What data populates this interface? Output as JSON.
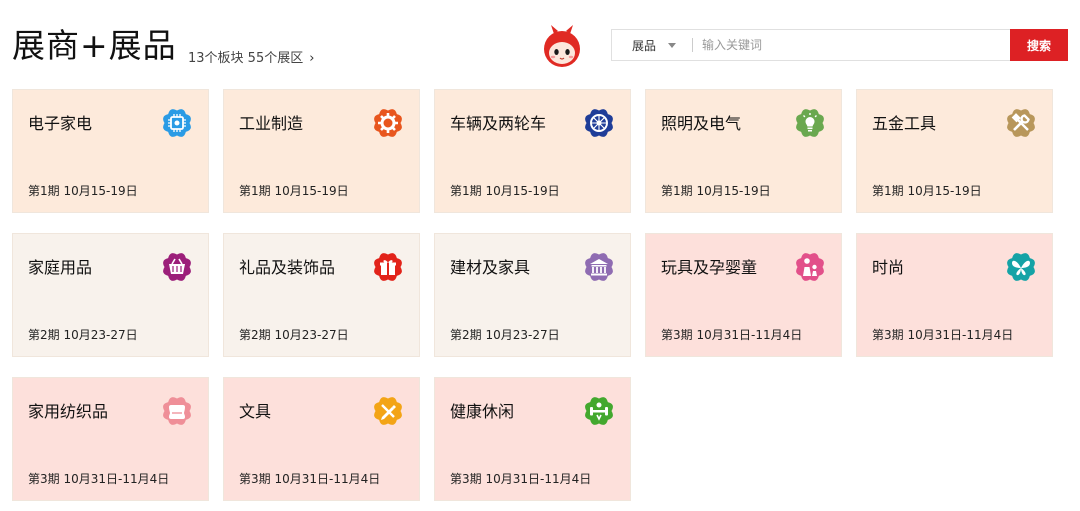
{
  "header": {
    "title": "展商+展品",
    "subinfo": "13个板块 55个展区",
    "subinfo_chevron": "›"
  },
  "search": {
    "category": "展品",
    "placeholder": "输入关键词",
    "button_label": "搜索"
  },
  "colors": {
    "phase1_bg": "#fdeadb",
    "phase2_bg": "#f8f2ec",
    "phase3_bg": "#fde0db",
    "search_button": "#dd2124"
  },
  "categories": [
    {
      "name": "电子家电",
      "period": "第1期 10月15-19日",
      "icon": "chip-icon",
      "icon_color": "#2a9be5"
    },
    {
      "name": "工业制造",
      "period": "第1期 10月15-19日",
      "icon": "gear-icon",
      "icon_color": "#e8561e"
    },
    {
      "name": "车辆及两轮车",
      "period": "第1期 10月15-19日",
      "icon": "wheel-icon",
      "icon_color": "#1f3d98"
    },
    {
      "name": "照明及电气",
      "period": "第1期 10月15-19日",
      "icon": "lightbulb-icon",
      "icon_color": "#6aa84f"
    },
    {
      "name": "五金工具",
      "period": "第1期 10月15-19日",
      "icon": "tools-icon",
      "icon_color": "#b8975b"
    },
    {
      "name": "家庭用品",
      "period": "第2期 10月23-27日",
      "icon": "basket-icon",
      "icon_color": "#9c1f7a"
    },
    {
      "name": "礼品及装饰品",
      "period": "第2期 10月23-27日",
      "icon": "gift-icon",
      "icon_color": "#e2231a"
    },
    {
      "name": "建材及家具",
      "period": "第2期 10月23-27日",
      "icon": "building-icon",
      "icon_color": "#8f6cb2"
    },
    {
      "name": "玩具及孕婴童",
      "period": "第3期 10月31日-11月4日",
      "icon": "mother-child-icon",
      "icon_color": "#e2508a"
    },
    {
      "name": "时尚",
      "period": "第3期 10月31日-11月4日",
      "icon": "butterfly-icon",
      "icon_color": "#15a3a6"
    },
    {
      "name": "家用纺织品",
      "period": "第3期 10月31日-11月4日",
      "icon": "pillow-icon",
      "icon_color": "#ef8f98"
    },
    {
      "name": "文具",
      "period": "第3期 10月31日-11月4日",
      "icon": "stationery-icon",
      "icon_color": "#f3a416"
    },
    {
      "name": "健康休闲",
      "period": "第3期 10月31日-11月4日",
      "icon": "fitness-icon",
      "icon_color": "#43a82e"
    }
  ]
}
